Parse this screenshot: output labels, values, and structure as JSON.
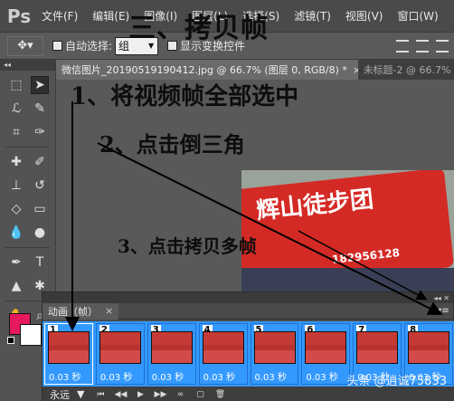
{
  "app": {
    "logo": "Ps"
  },
  "menu": [
    "文件(F)",
    "编辑(E)",
    "图像(I)",
    "图层(L)",
    "选择(S)",
    "滤镜(T)",
    "视图(V)",
    "窗口(W)"
  ],
  "options": {
    "auto_select_label": "自动选择:",
    "auto_select_value": "组",
    "show_transform_label": "显示变换控件"
  },
  "overlay": {
    "title": "三、拷贝帧",
    "step1": "1、将视频帧全部选中",
    "step2": "2、点击倒三角",
    "step3": "3、点击拷贝多帧"
  },
  "tabs": [
    {
      "label": "微信图片_20190519190412.jpg @ 66.7% (图层 0, RGB/8) *",
      "close": "×"
    },
    {
      "label": "未标题-2 @ 66.7%"
    }
  ],
  "photo": {
    "flag_text": "辉山徒步团",
    "flag_number": "182956128"
  },
  "animation_panel": {
    "tab_label": "动画（帧）",
    "tab_close": "×",
    "loop": "永远",
    "frames": [
      {
        "num": "1",
        "time": "0.03 秒"
      },
      {
        "num": "2",
        "time": "0.03 秒"
      },
      {
        "num": "3",
        "time": "0.03 秒"
      },
      {
        "num": "4",
        "time": "0.03 秒"
      },
      {
        "num": "5",
        "time": "0.03 秒"
      },
      {
        "num": "6",
        "time": "0.03 秒"
      },
      {
        "num": "7",
        "time": "0.03 秒"
      },
      {
        "num": "8",
        "time": "0.03 秒"
      }
    ]
  },
  "watermark": "头条 @逍诚75833",
  "colors": {
    "foreground": "#e6195f",
    "background": "#ffffff",
    "frame_selection": "#3399ff"
  }
}
